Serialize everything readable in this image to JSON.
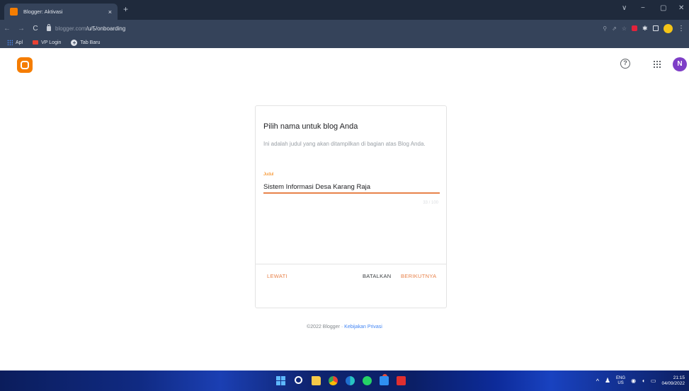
{
  "browser": {
    "tab_title": "Blogger: Aktivasi",
    "tab_close": "×",
    "new_tab": "+",
    "window_controls": {
      "collapse": "∨",
      "minimize": "−",
      "restore": "▢",
      "close": "✕"
    },
    "nav": {
      "back": "←",
      "forward": "→",
      "reload": "C"
    },
    "url_host": "blogger.com",
    "url_path": "/u/5/onboarding",
    "toolbar_icons": {
      "zoom": "⚲",
      "share": "⇗",
      "star": "☆",
      "puzzle": "✱",
      "menu": "⋮"
    },
    "bookmarks": [
      {
        "label": "Apl",
        "icon": "apps-grid-icon"
      },
      {
        "label": "VP Login",
        "icon": "folder-icon"
      },
      {
        "label": "Tab Baru",
        "icon": "plus-circle-icon"
      }
    ]
  },
  "header": {
    "help_glyph": "?",
    "avatar_letter": "N",
    "brand_color": "#f57d00",
    "avatar_color": "#7e3ec7"
  },
  "dialog": {
    "title": "Pilih nama untuk blog Anda",
    "description": "Ini adalah judul yang akan ditampilkan di bagian atas Blog Anda.",
    "field_label": "Judul",
    "field_value": "Sistem Informasi Desa Karang Raja",
    "char_count": "33 / 100",
    "skip_label": "LEWATI",
    "cancel_label": "BATALKAN",
    "next_label": "BERIKUTNYA",
    "accent_color": "#e8824a"
  },
  "footer": {
    "copyright": "©2022 Blogger · ",
    "privacy_link": "Kebijakan Privasi"
  },
  "taskbar": {
    "tray_chevron": "^",
    "lang_top": "ENG",
    "lang_bottom": "US",
    "time": "21:15",
    "date": "04/09/2022"
  }
}
